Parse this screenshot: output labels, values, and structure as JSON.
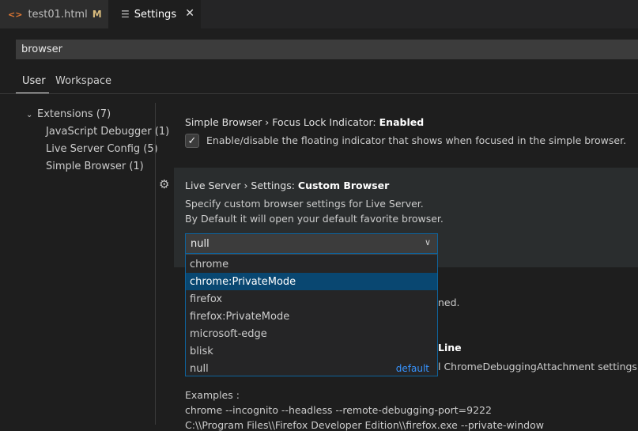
{
  "tabs": [
    {
      "label": "test01.html",
      "modified": "M",
      "icon": "html-icon"
    },
    {
      "label": "Settings",
      "icon": "settings-lines-icon"
    }
  ],
  "search": {
    "value": "browser"
  },
  "scopes": [
    {
      "label": "User"
    },
    {
      "label": "Workspace"
    }
  ],
  "toc": [
    {
      "label": "Extensions (7)"
    },
    {
      "label": "JavaScript Debugger (1)"
    },
    {
      "label": "Live Server Config (5)"
    },
    {
      "label": "Simple Browser (1)"
    }
  ],
  "settings": {
    "focus_lock": {
      "title_prefix": "Simple Browser › Focus Lock Indicator:",
      "title_name": "Enabled",
      "desc": "Enable/disable the floating indicator that shows when focused in the simple browser.",
      "checked": true
    },
    "custom_browser": {
      "title_prefix": "Live Server › Settings:",
      "title_name": "Custom Browser",
      "desc1": "Specify custom browser settings for Live Server.",
      "desc2": "By Default it will open your default favorite browser.",
      "selected": "null",
      "options": [
        {
          "label": "chrome"
        },
        {
          "label": "chrome:PrivateMode"
        },
        {
          "label": "firefox"
        },
        {
          "label": "firefox:PrivateMode"
        },
        {
          "label": "microsoft-edge"
        },
        {
          "label": "blisk"
        },
        {
          "label": "null",
          "badge": "default"
        }
      ],
      "highlighted_option": "chrome:PrivateMode"
    }
  },
  "partial": {
    "text1": "ned.",
    "title_fragment": "Line",
    "text2": "l ChromeDebuggingAttachment settings.",
    "examples_label": "Examples :",
    "example1": "chrome --incognito --headless --remote-debugging-port=9222",
    "example2": "C:\\\\Program Files\\\\Firefox Developer Edition\\\\firefox.exe --private-window"
  }
}
